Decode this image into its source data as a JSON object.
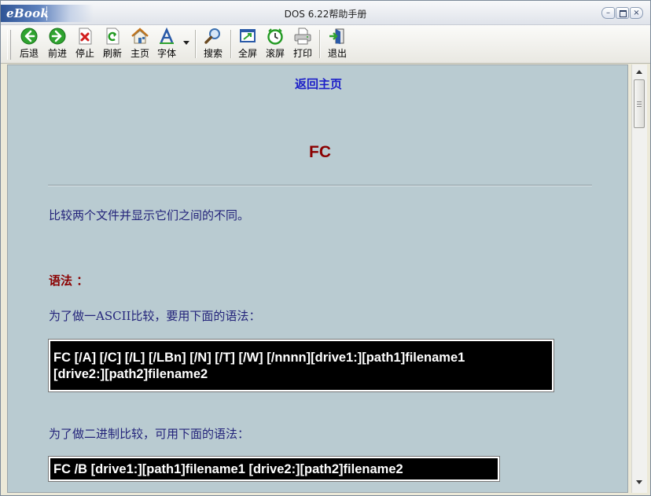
{
  "window": {
    "logo": "eBook",
    "title": "DOS  6.22帮助手册",
    "controls": {
      "minimize": "–",
      "maximize": "□",
      "close": "×"
    }
  },
  "toolbar": {
    "items": [
      {
        "label": "后退",
        "icon": "back-arrow-icon",
        "color": "#2a9a2a"
      },
      {
        "label": "前进",
        "icon": "forward-arrow-icon",
        "color": "#2a9a2a"
      },
      {
        "label": "停止",
        "icon": "stop-icon",
        "color": "#cc2020"
      },
      {
        "label": "刷新",
        "icon": "refresh-icon",
        "color": "#2a9a2a"
      },
      {
        "label": "主页",
        "icon": "home-icon",
        "color": "#d98b20"
      },
      {
        "label": "字体",
        "icon": "font-icon",
        "color": "#2a6ac0"
      },
      {
        "label": "搜索",
        "icon": "search-icon",
        "color": "#3a6fb0"
      },
      {
        "label": "全屏",
        "icon": "fullscreen-icon",
        "color": "#2a6ac0"
      },
      {
        "label": "滚屏",
        "icon": "scroll-clock-icon",
        "color": "#2a9a2a"
      },
      {
        "label": "打印",
        "icon": "printer-icon",
        "color": "#666666"
      },
      {
        "label": "退出",
        "icon": "exit-icon",
        "color": "#2a9a2a"
      }
    ]
  },
  "page": {
    "home_link": "返回主页",
    "command_title": "FC",
    "description": "比较两个文件并显示它们之间的不同。",
    "syntax_heading": "语法 ：",
    "ascii_intro": "为了做一ASCII比较，要用下面的语法：",
    "ascii_syntax_line1": "FC [/A] [/C] [/L] [/LBn] [/N] [/T] [/W] [/nnnn][drive1:][path1]filename1",
    "ascii_syntax_line2": "[drive2:][path2]filename2",
    "binary_intro": "为了做二进制比较，可用下面的语法：",
    "binary_syntax": "FC /B [drive1:][path1]filename1 [drive2:][path2]filename2"
  },
  "colors": {
    "content_background": "#b9cbd1",
    "link": "#1d20c8",
    "heading": "#8b0000",
    "body_text": "#23237a",
    "code_background": "#000000",
    "code_text": "#ffffff"
  }
}
